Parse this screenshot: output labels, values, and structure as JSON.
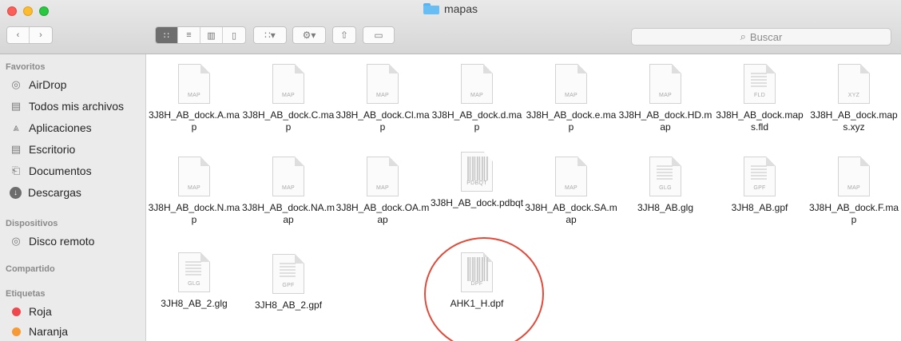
{
  "window": {
    "title": "mapas",
    "folder_icon": "folder-icon"
  },
  "toolbar": {
    "back_icon": "chevron-left-icon",
    "forward_icon": "chevron-right-icon",
    "view_modes": [
      "icon-view",
      "list-view",
      "column-view",
      "cover-flow-view"
    ],
    "arrange_icon": "grid-arrange-icon",
    "action_icon": "gear-icon",
    "share_icon": "share-icon",
    "tag_icon": "tag-icon",
    "search_placeholder": "Buscar",
    "search_icon": "search-icon"
  },
  "sidebar": {
    "sections": [
      {
        "heading": "Favoritos",
        "items": [
          {
            "label": "AirDrop",
            "icon": "airdrop-icon"
          },
          {
            "label": "Todos mis archivos",
            "icon": "all-files-icon"
          },
          {
            "label": "Aplicaciones",
            "icon": "applications-icon"
          },
          {
            "label": "Escritorio",
            "icon": "desktop-icon"
          },
          {
            "label": "Documentos",
            "icon": "documents-icon"
          },
          {
            "label": "Descargas",
            "icon": "downloads-icon"
          }
        ]
      },
      {
        "heading": "Dispositivos",
        "items": [
          {
            "label": "Disco remoto",
            "icon": "remote-disc-icon"
          }
        ]
      },
      {
        "heading": "Compartido",
        "items": []
      },
      {
        "heading": "Etiquetas",
        "items": [
          {
            "label": "Roja",
            "color": "#f0474e"
          },
          {
            "label": "Naranja",
            "color": "#f79a34"
          }
        ]
      }
    ]
  },
  "files": [
    {
      "name": "3J8H_AB_dock.A.map",
      "ext": "MAP"
    },
    {
      "name": "3J8H_AB_dock.C.map",
      "ext": "MAP"
    },
    {
      "name": "3J8H_AB_dock.Cl.map",
      "ext": "MAP"
    },
    {
      "name": "3J8H_AB_dock.d.map",
      "ext": "MAP"
    },
    {
      "name": "3J8H_AB_dock.e.map",
      "ext": "MAP"
    },
    {
      "name": "3J8H_AB_dock.HD.map",
      "ext": "MAP"
    },
    {
      "name": "3J8H_AB_dock.maps.fld",
      "ext": "FLD"
    },
    {
      "name": "3J8H_AB_dock.maps.xyz",
      "ext": "XYZ"
    },
    {
      "name": "3J8H_AB_dock.N.map",
      "ext": "MAP"
    },
    {
      "name": "3J8H_AB_dock.NA.map",
      "ext": "MAP"
    },
    {
      "name": "3J8H_AB_dock.OA.map",
      "ext": "MAP"
    },
    {
      "name": "3J8H_AB_dock.pdbqt",
      "ext": "PDBQT"
    },
    {
      "name": "3J8H_AB_dock.SA.map",
      "ext": "MAP"
    },
    {
      "name": "3JH8_AB.glg",
      "ext": "GLG"
    },
    {
      "name": "3JH8_AB.gpf",
      "ext": "GPF"
    },
    {
      "name": "3J8H_AB_dock.F.map",
      "ext": "MAP"
    },
    {
      "name": "3JH8_AB_2.glg",
      "ext": "GLG"
    },
    {
      "name": "3JH8_AB_2.gpf",
      "ext": "GPF"
    },
    {
      "name": "",
      "ext": ""
    },
    {
      "name": "AHK1_H.dpf",
      "ext": "DPF"
    }
  ],
  "annotation": {
    "color": "#e04a3a",
    "target": "AHK1_H.dpf"
  }
}
